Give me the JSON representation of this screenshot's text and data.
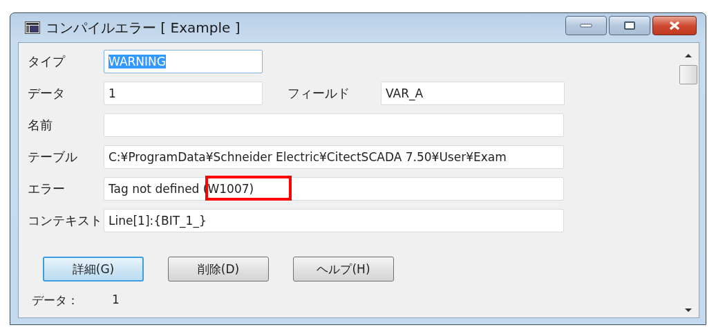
{
  "window": {
    "title": "コンパイルエラー [ Example ]"
  },
  "fields": [
    {
      "label": "タイプ",
      "value": "WARNING",
      "text_selected": true,
      "kind": "short"
    },
    {
      "label": "データ",
      "value": "1",
      "text_selected": false,
      "kind": "short",
      "side": {
        "label": "フィールド",
        "value": "VAR_A"
      }
    },
    {
      "label": "名前",
      "kind": "long"
    },
    {
      "label": "テーブル",
      "value": "C:¥ProgramData¥Schneider Electric¥CitectSCADA 7.50¥User¥Exam",
      "text_selected": false,
      "kind": "long"
    },
    {
      "label": "エラー",
      "value": "Tag not defined (W1007)",
      "text_selected": false,
      "kind": "long",
      "annotation": {
        "kind": "rectangle",
        "color": "#ff0000"
      }
    },
    {
      "label": "コンテキスト",
      "value": "Line[1]:{BIT_1_}",
      "text_selected": false,
      "kind": "long"
    }
  ],
  "buttons": [
    {
      "label": "詳細(G)",
      "default": true
    },
    {
      "label": "削除(D)",
      "default": false
    },
    {
      "label": "ヘルプ(H)",
      "default": false
    }
  ],
  "status": {
    "label": "データ：",
    "value": "1"
  }
}
